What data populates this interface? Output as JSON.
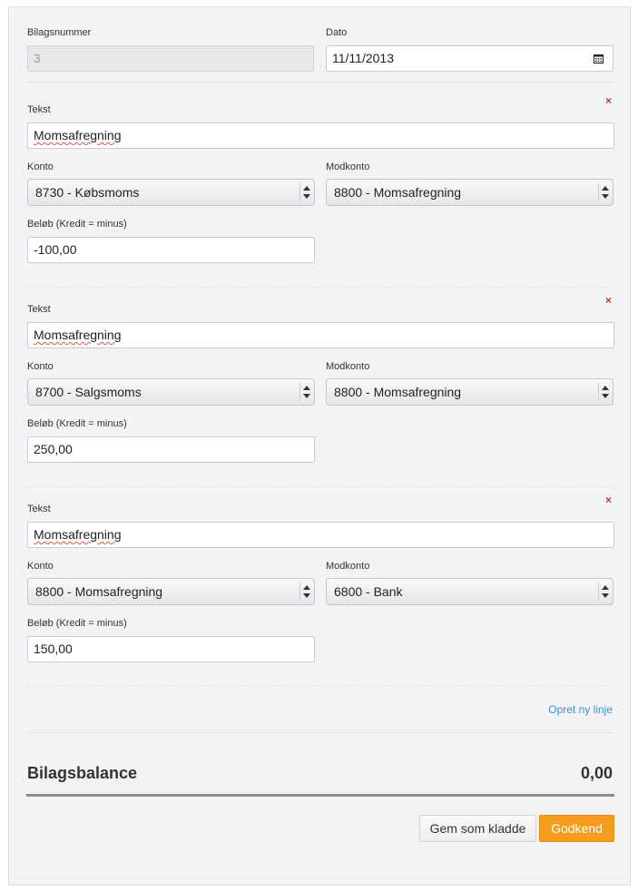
{
  "header": {
    "bilagsnummer_label": "Bilagsnummer",
    "bilagsnummer_value": "3",
    "dato_label": "Dato",
    "dato_value": "11/11/2013"
  },
  "lines": [
    {
      "tekst_label": "Tekst",
      "tekst_value": "Momsafregning",
      "konto_label": "Konto",
      "konto_value": "8730 - Købsmoms",
      "modkonto_label": "Modkonto",
      "modkonto_value": "8800 - Momsafregning",
      "beloeb_label": "Beløb (Kredit = minus)",
      "beloeb_value": "-100,00",
      "remove": "×"
    },
    {
      "tekst_label": "Tekst",
      "tekst_value": "Momsafregning",
      "konto_label": "Konto",
      "konto_value": "8700 - Salgsmoms",
      "modkonto_label": "Modkonto",
      "modkonto_value": "8800 - Momsafregning",
      "beloeb_label": "Beløb (Kredit = minus)",
      "beloeb_value": "250,00",
      "remove": "×"
    },
    {
      "tekst_label": "Tekst",
      "tekst_value": "Momsafregning",
      "konto_label": "Konto",
      "konto_value": "8800 - Momsafregning",
      "modkonto_label": "Modkonto",
      "modkonto_value": "6800 - Bank",
      "beloeb_label": "Beløb (Kredit = minus)",
      "beloeb_value": "150,00",
      "remove": "×"
    }
  ],
  "add_line_link": "Opret ny linje",
  "balance": {
    "label": "Bilagsbalance",
    "value": "0,00"
  },
  "buttons": {
    "save_draft": "Gem som kladde",
    "approve": "Godkend"
  },
  "colors": {
    "accent": "#f39c1e",
    "link": "#3a8fd3",
    "remove": "#c0392b"
  },
  "icons": {
    "date": "calendar-icon",
    "remove": "remove-x-icon",
    "select": "select-arrows-icon"
  }
}
